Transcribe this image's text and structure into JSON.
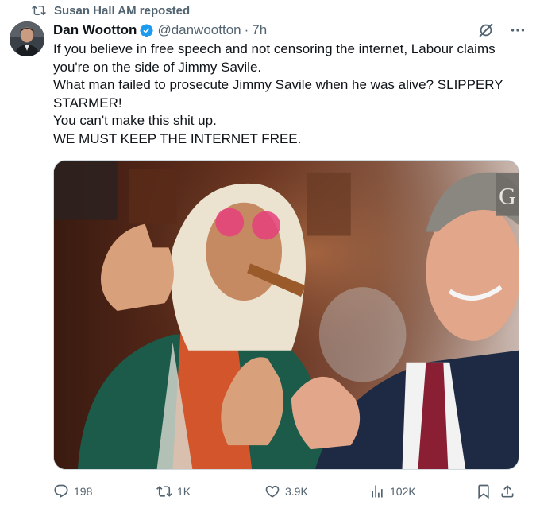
{
  "repost": {
    "label": "Susan Hall AM reposted",
    "icon": "repost-icon"
  },
  "author": {
    "name": "Dan Wootton",
    "verified": true,
    "handle": "@danwootton",
    "separator": "·",
    "time": "7h",
    "avatar_icon": "avatar"
  },
  "tweet": {
    "lines": [
      "If you believe in free speech and not censoring the internet, Labour claims you're on the side of Jimmy Savile.",
      "What man failed to prosecute Jimmy Savile when he was alive? SLIPPERY STARMER!",
      "You can't make this shit up.",
      "WE MUST KEEP THE INTERNET FREE."
    ]
  },
  "media": {
    "corner_glyph": "G"
  },
  "actions": {
    "replies": "198",
    "reposts": "1K",
    "likes": "3.9K",
    "views": "102K"
  },
  "colors": {
    "text": "#0f1419",
    "muted": "#536471",
    "verified": "#1d9bf0",
    "border": "#cfd9de"
  }
}
